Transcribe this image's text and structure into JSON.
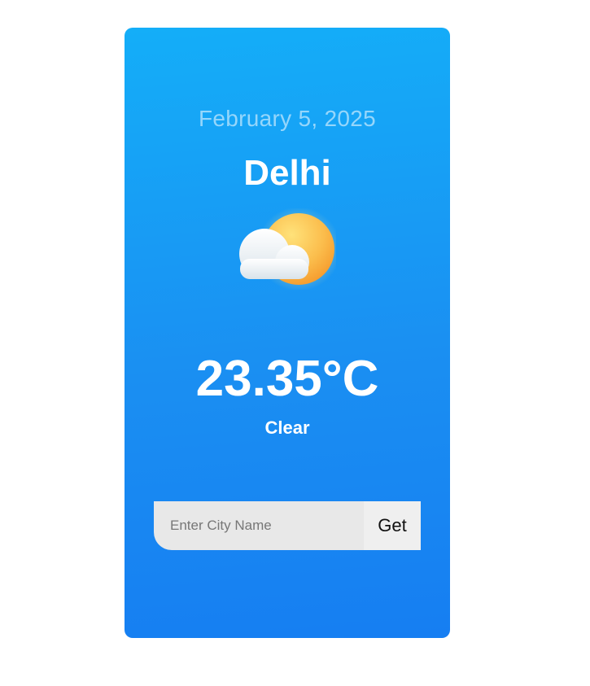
{
  "weather": {
    "date": "February 5, 2025",
    "city": "Delhi",
    "icon": "partly-cloudy-icon",
    "temperature": "23.35°C",
    "condition": "Clear"
  },
  "search": {
    "placeholder": "Enter City Name",
    "value": "",
    "button_label": "Get"
  },
  "colors": {
    "card_gradient_top": "#14aef8",
    "card_gradient_bottom": "#167ef2",
    "sun": "#f9a83a",
    "input_bg": "#e8e8e8"
  }
}
